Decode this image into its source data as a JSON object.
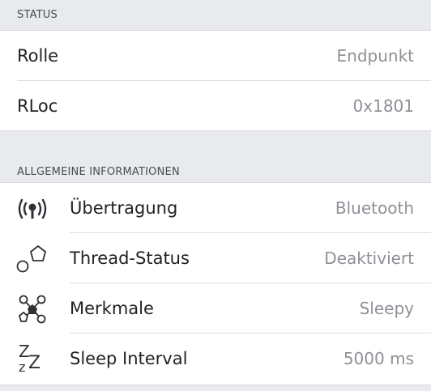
{
  "status": {
    "header": "STATUS",
    "rows": [
      {
        "label": "Rolle",
        "value": "Endpunkt"
      },
      {
        "label": "RLoc",
        "value": "0x1801"
      }
    ]
  },
  "general": {
    "header": "ALLGEMEINE INFORMATIONEN",
    "rows": [
      {
        "icon": "broadcast-icon",
        "label": "Übertragung",
        "value": "Bluetooth"
      },
      {
        "icon": "thread-shapes-icon",
        "label": "Thread-Status",
        "value": "Deaktiviert"
      },
      {
        "icon": "network-nodes-icon",
        "label": "Merkmale",
        "value": "Sleepy"
      },
      {
        "icon": "sleep-zz-icon",
        "label": "Sleep Interval",
        "value": "5000 ms"
      }
    ]
  },
  "colors": {
    "background": "#e8eaed",
    "card": "#ffffff",
    "label_text": "#1f2124",
    "value_text": "#8d9096",
    "header_text": "#4a4d52",
    "separator": "#dcdee1"
  }
}
